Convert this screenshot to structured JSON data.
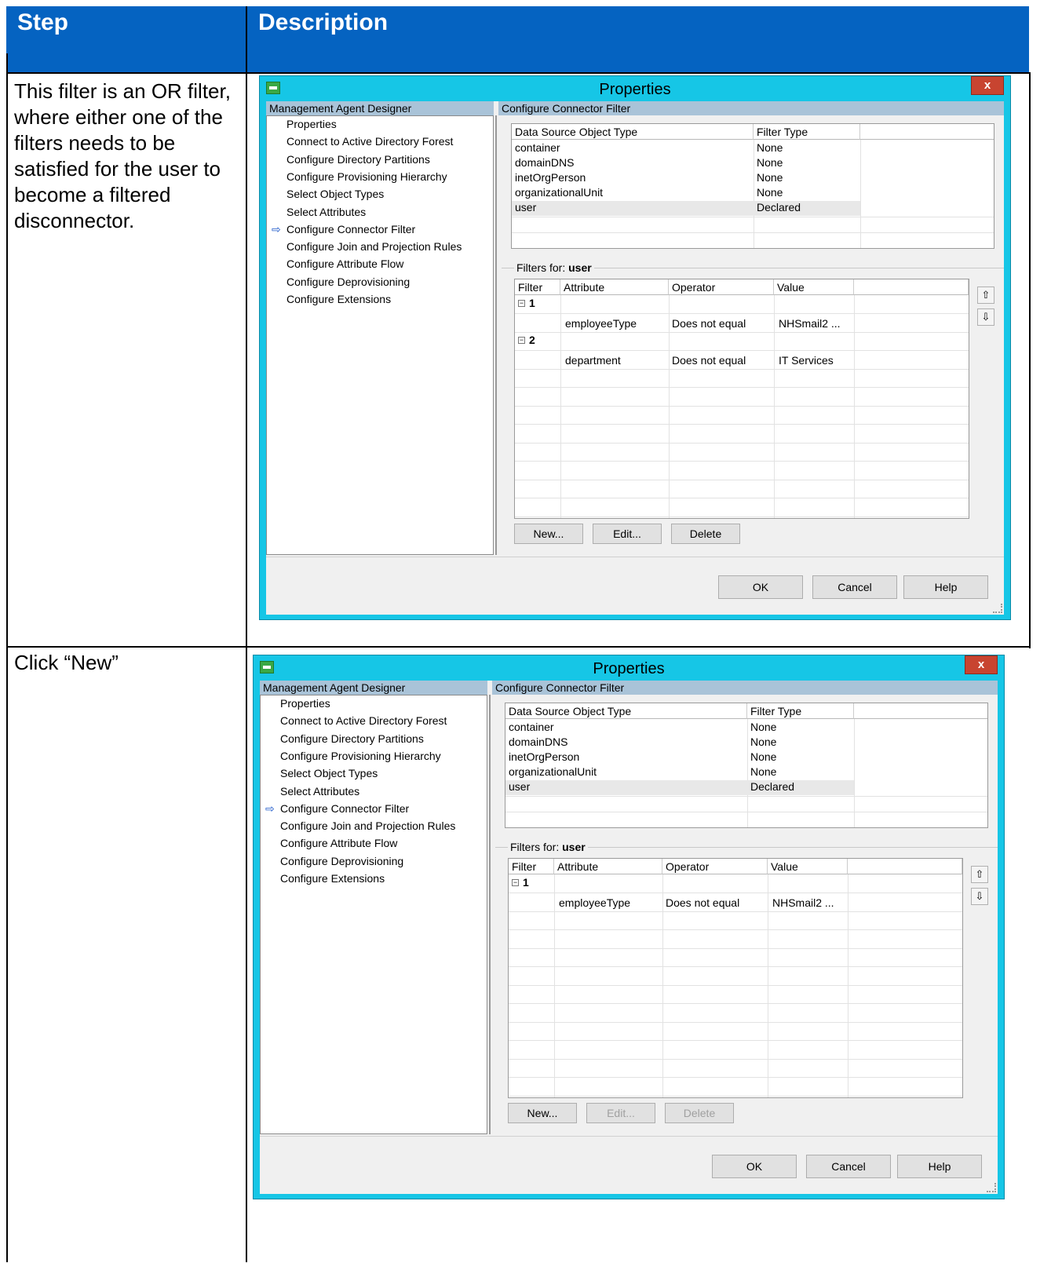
{
  "table": {
    "step_header": "Step",
    "description_header": "Description",
    "rows": [
      {
        "step_text": "This filter is an OR filter, where either one of the filters needs to be satisfied for the user to become a filtered disconnector."
      },
      {
        "step_text": "Click “New”"
      }
    ]
  },
  "dialogs": [
    {
      "title": "Properties",
      "close_label": "x",
      "left_header": "Management Agent Designer",
      "right_header": "Configure Connector Filter",
      "nav_items": [
        "Properties",
        "Connect to Active Directory Forest",
        "Configure Directory Partitions",
        "Configure Provisioning Hierarchy",
        "Select Object Types",
        "Select Attributes",
        "Configure Connector Filter",
        "Configure Join and Projection Rules",
        "Configure Attribute Flow",
        "Configure Deprovisioning",
        "Configure Extensions"
      ],
      "selected_nav": "Configure Connector Filter",
      "object_columns": [
        "Data Source Object Type",
        "Filter Type"
      ],
      "object_rows": [
        [
          "container",
          "None"
        ],
        [
          "domainDNS",
          "None"
        ],
        [
          "inetOrgPerson",
          "None"
        ],
        [
          "organizationalUnit",
          "None"
        ],
        [
          "user",
          "Declared"
        ]
      ],
      "filters_for_label": "Filters for:",
      "filters_for_value": "user",
      "filter_columns": [
        "Filter",
        "Attribute",
        "Operator",
        "Value"
      ],
      "filter_groups": [
        {
          "id": "1",
          "attribute": "employeeType",
          "operator": "Does not equal",
          "value": "NHSmail2 ..."
        },
        {
          "id": "2",
          "attribute": "department",
          "operator": "Does not equal",
          "value": "IT Services"
        }
      ],
      "buttons": {
        "new": "New...",
        "edit": "Edit...",
        "delete": "Delete",
        "ok": "OK",
        "cancel": "Cancel",
        "help": "Help"
      },
      "edit_enabled": true,
      "expander_icon": "minus-box-icon"
    },
    {
      "title": "Properties",
      "close_label": "x",
      "left_header": "Management Agent Designer",
      "right_header": "Configure Connector Filter",
      "nav_items": [
        "Properties",
        "Connect to Active Directory Forest",
        "Configure Directory Partitions",
        "Configure Provisioning Hierarchy",
        "Select Object Types",
        "Select Attributes",
        "Configure Connector Filter",
        "Configure Join and Projection Rules",
        "Configure Attribute Flow",
        "Configure Deprovisioning",
        "Configure Extensions"
      ],
      "selected_nav": "Configure Connector Filter",
      "object_columns": [
        "Data Source Object Type",
        "Filter Type"
      ],
      "object_rows": [
        [
          "container",
          "None"
        ],
        [
          "domainDNS",
          "None"
        ],
        [
          "inetOrgPerson",
          "None"
        ],
        [
          "organizationalUnit",
          "None"
        ],
        [
          "user",
          "Declared"
        ]
      ],
      "filters_for_label": "Filters for:",
      "filters_for_value": "user",
      "filter_columns": [
        "Filter",
        "Attribute",
        "Operator",
        "Value"
      ],
      "filter_groups": [
        {
          "id": "1",
          "attribute": "employeeType",
          "operator": "Does not equal",
          "value": "NHSmail2 ..."
        }
      ],
      "buttons": {
        "new": "New...",
        "edit": "Edit...",
        "delete": "Delete",
        "ok": "OK",
        "cancel": "Cancel",
        "help": "Help"
      },
      "edit_enabled": false,
      "expander_icon": "minus-box-icon"
    }
  ],
  "colors": {
    "header_blue": "#0563c1",
    "dialog_frame": "#16c6e6",
    "close_red": "#c84430",
    "pane_header": "#a9c3d8"
  }
}
